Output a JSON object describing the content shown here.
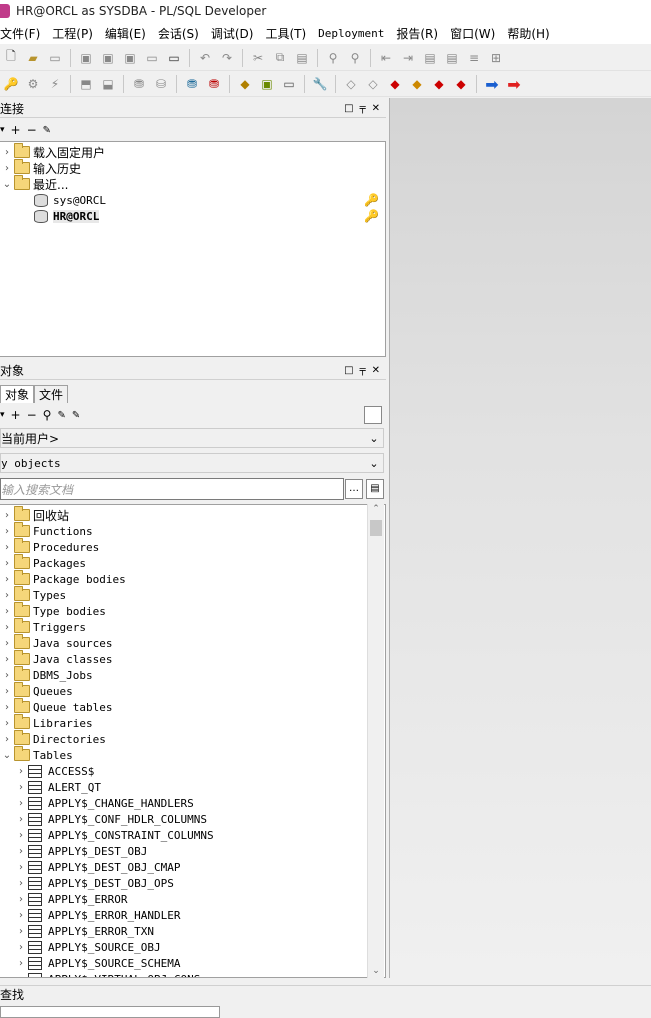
{
  "window": {
    "title": "HR@ORCL as SYSDBA - PL/SQL Developer"
  },
  "menu": [
    "文件(F)",
    "工程(P)",
    "编辑(E)",
    "会话(S)",
    "调试(D)",
    "工具(T)",
    "Deployment",
    "报告(R)",
    "窗口(W)",
    "帮助(H)"
  ],
  "connections_panel": {
    "title": "连接",
    "items": [
      {
        "label": "载入固定用户"
      },
      {
        "label": "输入历史"
      },
      {
        "label": "最近..."
      },
      {
        "label": "sys@ORCL"
      },
      {
        "label": "HR@ORCL"
      }
    ]
  },
  "objects_panel": {
    "title": "对象",
    "tabs": [
      "对象",
      "文件"
    ],
    "user_combo": "当前用户>",
    "filter_combo": "y objects",
    "search_placeholder": "输入搜索文档",
    "folders": [
      "回收站",
      "Functions",
      "Procedures",
      "Packages",
      "Package bodies",
      "Types",
      "Type bodies",
      "Triggers",
      "Java sources",
      "Java classes",
      "DBMS_Jobs",
      "Queues",
      "Queue tables",
      "Libraries",
      "Directories",
      "Tables"
    ],
    "tables": [
      "ACCESS$",
      "ALERT_QT",
      "APPLY$_CHANGE_HANDLERS",
      "APPLY$_CONF_HDLR_COLUMNS",
      "APPLY$_CONSTRAINT_COLUMNS",
      "APPLY$_DEST_OBJ",
      "APPLY$_DEST_OBJ_CMAP",
      "APPLY$_DEST_OBJ_OPS",
      "APPLY$_ERROR",
      "APPLY$_ERROR_HANDLER",
      "APPLY$_ERROR_TXN",
      "APPLY$_SOURCE_OBJ",
      "APPLY$_SOURCE_SCHEMA",
      "APPLY$_VIRTUAL_OBJ_CONS"
    ]
  },
  "find_bar": {
    "title": "查找"
  }
}
